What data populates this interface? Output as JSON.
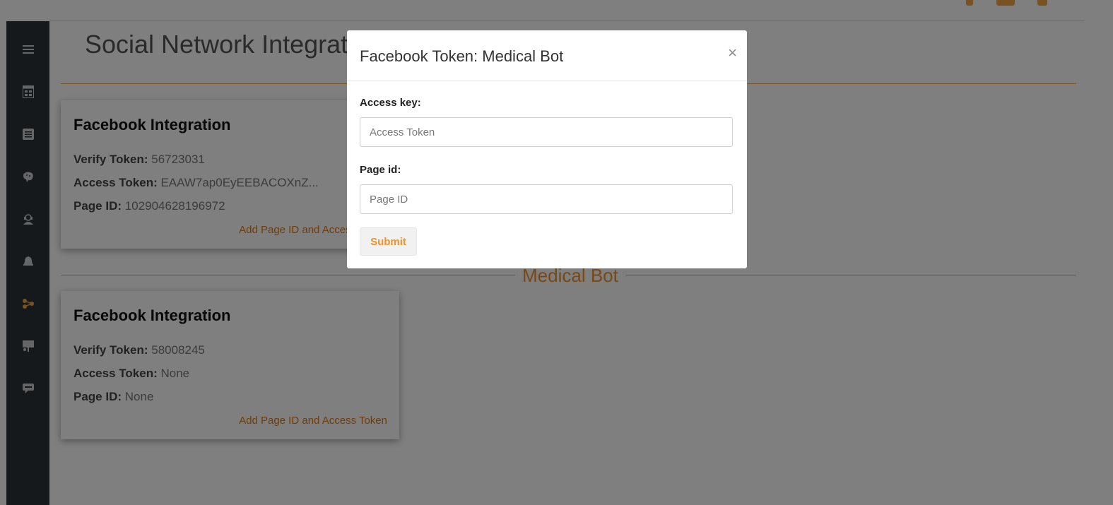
{
  "page": {
    "title": "Social Network Integration"
  },
  "sidebar": {
    "items": [
      {
        "icon": "menu-icon"
      },
      {
        "icon": "dashboard-icon"
      },
      {
        "icon": "list-icon"
      },
      {
        "icon": "brain-icon"
      },
      {
        "icon": "support-agent-icon"
      },
      {
        "icon": "bell-icon"
      },
      {
        "icon": "integration-icon",
        "active": true
      },
      {
        "icon": "presentation-icon"
      },
      {
        "icon": "faq-icon"
      }
    ]
  },
  "sections": [
    {
      "card": {
        "title": "Facebook Integration",
        "verify_label": "Verify Token:",
        "verify_value": "56723031",
        "access_label": "Access Token:",
        "access_value": "EAAW7ap0EyEEBACOXnZ...",
        "page_label": "Page ID:",
        "page_value": "102904628196972",
        "link": "Add Page ID and Access Token"
      }
    },
    {
      "label": "Medical Bot",
      "card": {
        "title": "Facebook Integration",
        "verify_label": "Verify Token:",
        "verify_value": "58008245",
        "access_label": "Access Token:",
        "access_value": "None",
        "page_label": "Page ID:",
        "page_value": "None",
        "link": "Add Page ID and Access Token"
      }
    }
  ],
  "modal": {
    "title": "Facebook Token: Medical Bot",
    "close": "×",
    "access_label": "Access key:",
    "access_placeholder": "Access Token",
    "page_label": "Page id:",
    "page_placeholder": "Page ID",
    "submit": "Submit"
  },
  "colors": {
    "accent": "#f0912a",
    "sidebar": "#2a3238",
    "overlay": "rgba(0,0,0,0.5)"
  }
}
